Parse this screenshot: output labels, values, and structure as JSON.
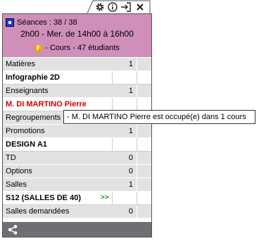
{
  "toolbar": {
    "icons": [
      "gear-icon",
      "info-icon",
      "exit-icon",
      "close-icon"
    ]
  },
  "header": {
    "sessions": "Séances : 38 / 38",
    "schedule": "2h00 - Mer. de 14h00 à 16h00",
    "type_letter": "F",
    "course": "- Cours - 47 étudiants",
    "color": "#cf8fb8"
  },
  "rows": [
    {
      "label": "Matières",
      "value": "1"
    },
    {
      "label": "Infographie 2D",
      "value": ""
    },
    {
      "label": "Enseignants",
      "value": "1"
    },
    {
      "label": "M. DI MARTINO Pierre",
      "value": ""
    },
    {
      "label": "Regroupements",
      "value": ""
    },
    {
      "label": "Promotions",
      "value": "1"
    },
    {
      "label": "DESIGN A1",
      "value": ""
    },
    {
      "label": "TD",
      "value": "0"
    },
    {
      "label": "Options",
      "value": "0"
    },
    {
      "label": "Salles",
      "value": "1"
    },
    {
      "label": "S12 (SALLES DE 40)",
      "value": "",
      "marker": ">>"
    },
    {
      "label": "Salles demandées",
      "value": "0"
    }
  ],
  "tooltip": "- M. DI MARTINO Pierre est occupé(e) dans 1 cours",
  "footer": {
    "icon": "share-icon"
  }
}
